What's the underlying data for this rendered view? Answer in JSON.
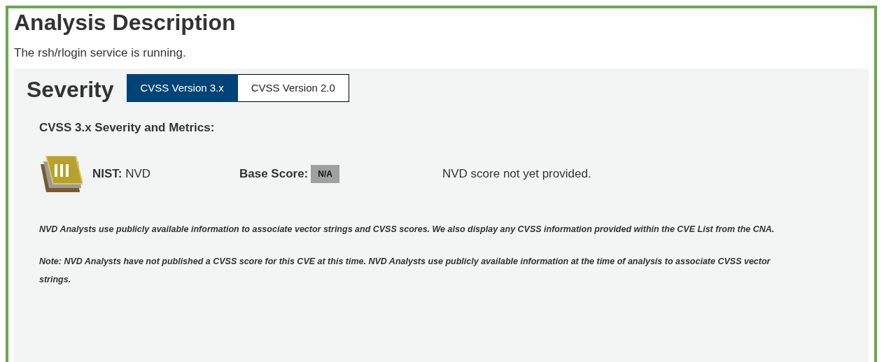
{
  "heading": "Analysis Description",
  "description": "The rsh/rlogin service is running.",
  "severity": {
    "title": "Severity",
    "tabs": [
      {
        "label": "CVSS Version 3.x",
        "selected": true
      },
      {
        "label": "CVSS Version 2.0",
        "selected": false
      }
    ],
    "subheading": "CVSS 3.x Severity and Metrics:",
    "metric": {
      "source_label": "NIST:",
      "source": "NVD",
      "score_label": "Base Score:",
      "score": "N/A",
      "message": "NVD score not yet provided."
    },
    "notes": [
      "NVD Analysts use publicly available information to associate vector strings and CVSS scores. We also display any CVSS information provided within the CVE List from the CNA.",
      "Note: NVD Analysts have not published a CVSS score for this CVE at this time. NVD Analysts use publicly available information at the time of analysis to associate CVSS vector strings."
    ]
  }
}
